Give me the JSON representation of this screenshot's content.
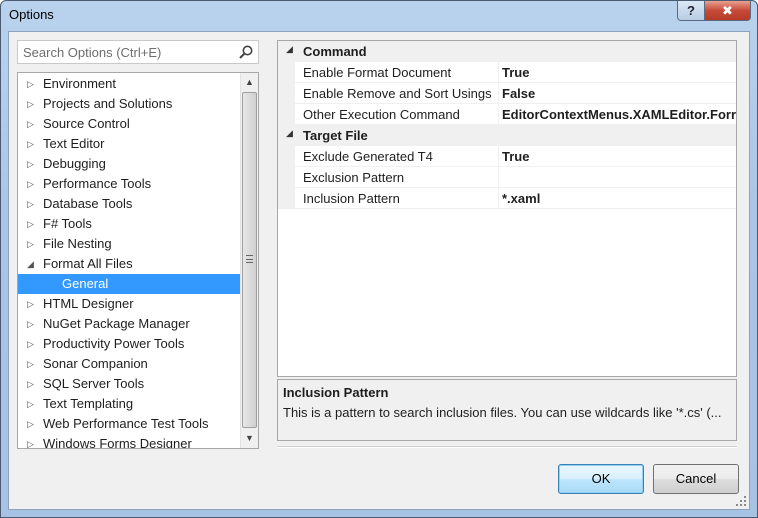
{
  "window": {
    "title": "Options",
    "help_glyph": "?",
    "close_glyph": "✖"
  },
  "search": {
    "placeholder": "Search Options (Ctrl+E)"
  },
  "tree": {
    "items": [
      {
        "label": "Environment",
        "expandable": true
      },
      {
        "label": "Projects and Solutions",
        "expandable": true
      },
      {
        "label": "Source Control",
        "expandable": true
      },
      {
        "label": "Text Editor",
        "expandable": true
      },
      {
        "label": "Debugging",
        "expandable": true
      },
      {
        "label": "Performance Tools",
        "expandable": true
      },
      {
        "label": "Database Tools",
        "expandable": true
      },
      {
        "label": "F# Tools",
        "expandable": true
      },
      {
        "label": "File Nesting",
        "expandable": true
      },
      {
        "label": "Format All Files",
        "expandable": true,
        "expanded": true
      },
      {
        "label": "General",
        "child": true,
        "selected": true
      },
      {
        "label": "HTML Designer",
        "expandable": true
      },
      {
        "label": "NuGet Package Manager",
        "expandable": true
      },
      {
        "label": "Productivity Power Tools",
        "expandable": true
      },
      {
        "label": "Sonar Companion",
        "expandable": true
      },
      {
        "label": "SQL Server Tools",
        "expandable": true
      },
      {
        "label": "Text Templating",
        "expandable": true
      },
      {
        "label": "Web Performance Test Tools",
        "expandable": true
      },
      {
        "label": "Windows Forms Designer",
        "expandable": true
      }
    ]
  },
  "grid": {
    "categories": [
      {
        "label": "Command",
        "properties": [
          {
            "name": "Enable Format Document",
            "value": "True"
          },
          {
            "name": "Enable Remove and Sort Usings",
            "value": "False"
          },
          {
            "name": "Other Execution Command",
            "value": "EditorContextMenus.XAMLEditor.Forr"
          }
        ]
      },
      {
        "label": "Target File",
        "properties": [
          {
            "name": "Exclude Generated T4",
            "value": "True"
          },
          {
            "name": "Exclusion Pattern",
            "value": ""
          },
          {
            "name": "Inclusion Pattern",
            "value": "*.xaml"
          }
        ]
      }
    ]
  },
  "description": {
    "title": "Inclusion Pattern",
    "text": "This is a pattern to search inclusion files. You can use wildcards like '*.cs' (..."
  },
  "buttons": {
    "ok": "OK",
    "cancel": "Cancel"
  },
  "colors": {
    "selection": "#3399ff",
    "accent_border": "#3c7fb1"
  }
}
